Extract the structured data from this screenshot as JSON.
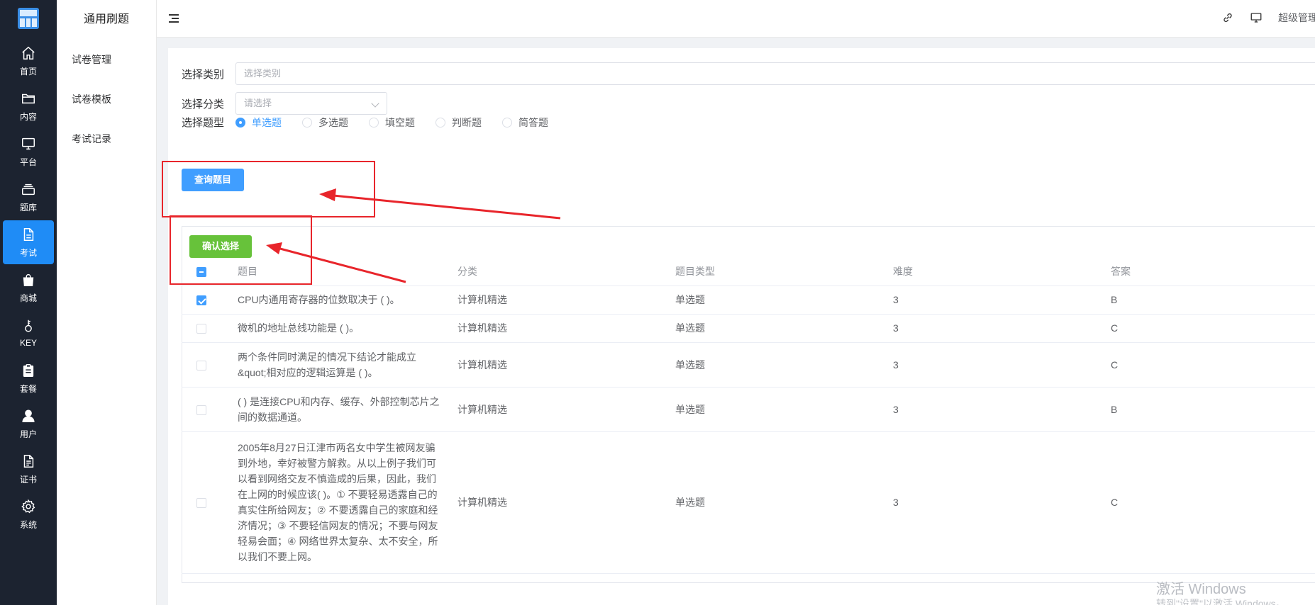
{
  "sidebar": {
    "items": [
      {
        "label": "首页",
        "icon": "home-icon"
      },
      {
        "label": "内容",
        "icon": "folder-icon"
      },
      {
        "label": "平台",
        "icon": "monitor-icon"
      },
      {
        "label": "题库",
        "icon": "stack-icon"
      },
      {
        "label": "考试",
        "icon": "document-icon",
        "active": true
      },
      {
        "label": "商城",
        "icon": "bag-icon"
      },
      {
        "label": "KEY",
        "icon": "key-icon"
      },
      {
        "label": "套餐",
        "icon": "clipboard-icon"
      },
      {
        "label": "用户",
        "icon": "user-icon"
      },
      {
        "label": "证书",
        "icon": "certificate-icon"
      },
      {
        "label": "系统",
        "icon": "gear-icon"
      }
    ]
  },
  "subnav": {
    "title": "通用刷题",
    "items": [
      "试卷管理",
      "试卷模板",
      "考试记录"
    ]
  },
  "header": {
    "admin": "超级管理员"
  },
  "form": {
    "category_label": "选择类别",
    "category_placeholder": "选择类别",
    "class_label": "选择分类",
    "class_placeholder": "请选择",
    "type_label": "选择题型",
    "types": [
      "单选题",
      "多选题",
      "填空题",
      "判断题",
      "简答题"
    ],
    "selected_type": "单选题",
    "query_button": "查询题目"
  },
  "table": {
    "confirm_button": "确认选择",
    "columns": [
      "题目",
      "分类",
      "题目类型",
      "难度",
      "答案"
    ],
    "rows": [
      {
        "title": "CPU内通用寄存器的位数取决于 ( )。",
        "category": "计算机精选",
        "type": "单选题",
        "difficulty": "3",
        "answer": "B",
        "checked": true
      },
      {
        "title": "微机的地址总线功能是 ( )。",
        "category": "计算机精选",
        "type": "单选题",
        "difficulty": "3",
        "answer": "C",
        "checked": false
      },
      {
        "title": "两个条件同时满足的情况下结论才能成立&quot;相对应的逻辑运算是 ( )。",
        "category": "计算机精选",
        "type": "单选题",
        "difficulty": "3",
        "answer": "C",
        "checked": false
      },
      {
        "title": "( ) 是连接CPU和内存、缓存、外部控制芯片之间的数据通道。",
        "category": "计算机精选",
        "type": "单选题",
        "difficulty": "3",
        "answer": "B",
        "checked": false
      },
      {
        "title": "2005年8月27日江津市两名女中学生被网友骗到外地，幸好被警方解救。从以上例子我们可以看到网络交友不慎造成的后果，因此，我们在上网的时候应该( )。① 不要轻易透露自己的真实住所给网友；② 不要透露自己的家庭和经济情况；③ 不要轻信网友的情况；不要与网友轻易会面；④ 网络世界太复杂、太不安全，所以我们不要上网。",
        "category": "计算机精选",
        "type": "单选题",
        "difficulty": "3",
        "answer": "C",
        "checked": false
      }
    ]
  },
  "watermark": {
    "line1": "激活 Windows",
    "line2": "转到\"设置\"以激活 Windows。"
  },
  "colors": {
    "sidebar_bg": "#1c2330",
    "active": "#1f8cf6",
    "primary": "#409eff",
    "success": "#67c23a",
    "annotation": "#e8252b"
  }
}
